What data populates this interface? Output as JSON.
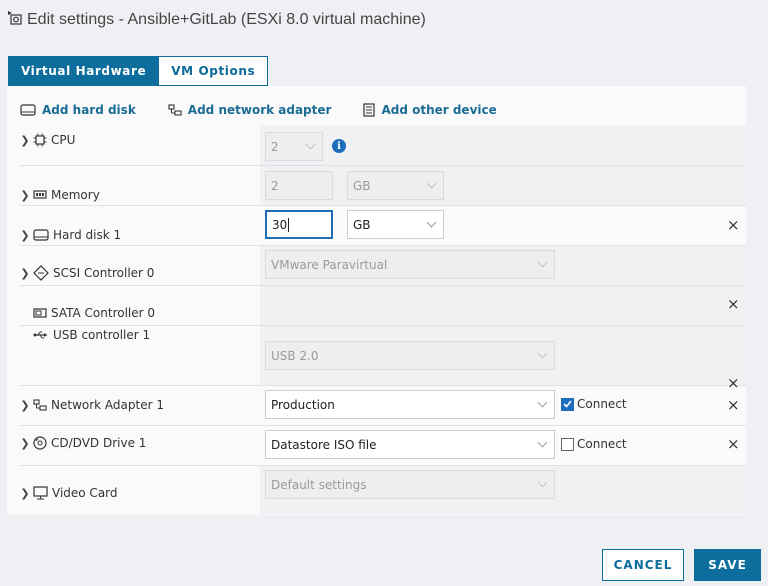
{
  "window": {
    "title": "Edit settings - Ansible+GitLab (ESXi 8.0 virtual machine)"
  },
  "tabs": [
    {
      "label": "Virtual Hardware",
      "active": true
    },
    {
      "label": "VM Options",
      "active": false
    }
  ],
  "actions": {
    "add_hard_disk": "Add hard disk",
    "add_network_adapter": "Add network adapter",
    "add_other_device": "Add other device"
  },
  "devices": {
    "cpu": {
      "label": "CPU",
      "value": "2"
    },
    "memory": {
      "label": "Memory",
      "value": "2",
      "unit": "GB"
    },
    "hard_disk": {
      "label": "Hard disk 1",
      "value": "30",
      "unit": "GB"
    },
    "scsi": {
      "label": "SCSI Controller 0",
      "value": "VMware Paravirtual"
    },
    "sata": {
      "label": "SATA Controller 0"
    },
    "usb": {
      "label": "USB controller 1",
      "value": "USB 2.0"
    },
    "network": {
      "label": "Network Adapter 1",
      "value": "Production",
      "connect_label": "Connect",
      "connected": true
    },
    "cdrom": {
      "label": "CD/DVD Drive 1",
      "value": "Datastore ISO file",
      "connect_label": "Connect",
      "connected": false
    },
    "video": {
      "label": "Video Card",
      "value": "Default settings"
    }
  },
  "footer": {
    "cancel": "CANCEL",
    "save": "SAVE"
  },
  "colors": {
    "accent": "#0d6d9c",
    "checkbox": "#1c6dbb"
  }
}
